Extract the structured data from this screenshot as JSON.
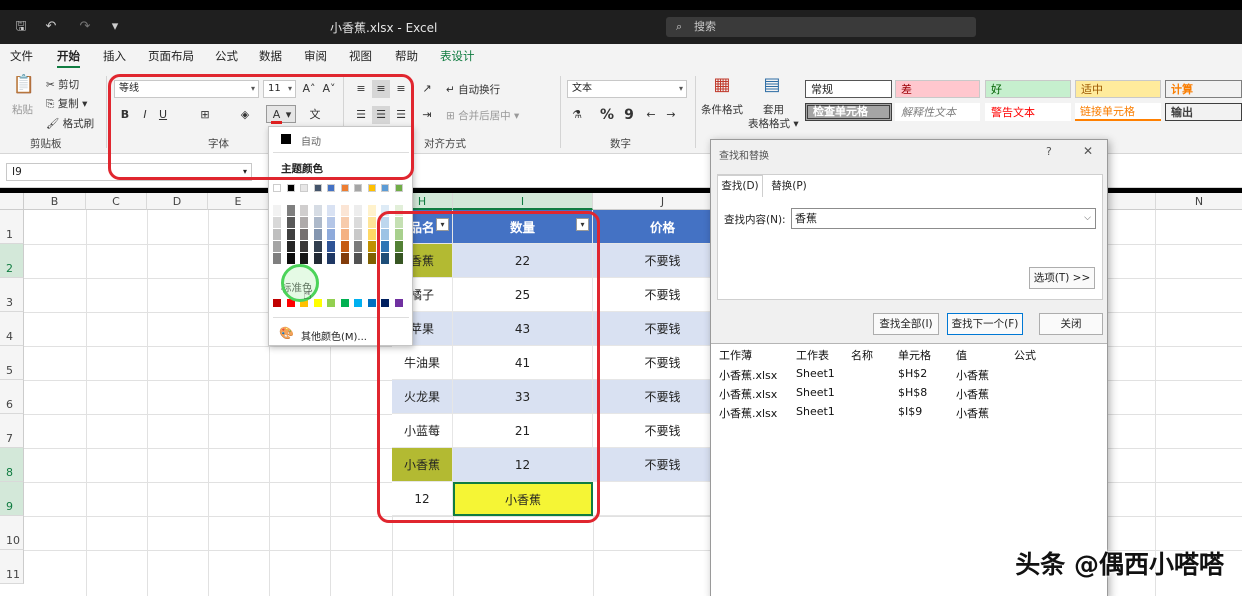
{
  "app": {
    "doc_title": "小香蕉.xlsx - Excel",
    "search_placeholder": "搜索"
  },
  "menu": [
    "文件",
    "开始",
    "插入",
    "页面布局",
    "公式",
    "数据",
    "审阅",
    "视图",
    "帮助",
    "表设计"
  ],
  "ribbon": {
    "paste": "粘贴",
    "cut": "剪切",
    "copy": "复制",
    "format_painter": "格式刷",
    "clipboard": "剪贴板",
    "font_name": "等线",
    "font_size": "11",
    "font_group": "字体",
    "wrap_text": "自动换行",
    "merge_center": "合并后居中",
    "align_group": "对齐方式",
    "number_format": "文本",
    "number_group": "数字",
    "cond_format": "条件格式",
    "table_format_line1": "套用",
    "table_format_line2": "表格格式",
    "styles": [
      "常规",
      "差",
      "好",
      "适中",
      "计算",
      "检查单元格",
      "解释性文本",
      "警告文本",
      "链接单元格",
      "输出"
    ]
  },
  "formula_bar": {
    "name_box": "I9"
  },
  "grid": {
    "columns": [
      "B",
      "C",
      "D",
      "E",
      "H",
      "I",
      "J",
      "N"
    ],
    "rows": [
      "1",
      "2",
      "3",
      "4",
      "5",
      "6",
      "7",
      "8",
      "9",
      "10",
      "11"
    ],
    "header": {
      "h": "品名",
      "i": "数量",
      "j": "价格"
    },
    "data": [
      {
        "h": "香蕉",
        "i": "22",
        "j": "不要钱"
      },
      {
        "h": "橘子",
        "i": "25",
        "j": "不要钱"
      },
      {
        "h": "苹果",
        "i": "43",
        "j": "不要钱"
      },
      {
        "h": "牛油果",
        "i": "41",
        "j": "不要钱"
      },
      {
        "h": "火龙果",
        "i": "33",
        "j": "不要钱"
      },
      {
        "h": "小蓝莓",
        "i": "21",
        "j": "不要钱"
      },
      {
        "h": "小香蕉",
        "i": "12",
        "j": "不要钱"
      },
      {
        "h": "12",
        "i": "小香蕉",
        "j": ""
      }
    ]
  },
  "color_menu": {
    "auto": "自动",
    "theme_colors": "主题颜色",
    "standard_colors": "标准色",
    "more_colors": "其他颜色(M)..."
  },
  "find_dialog": {
    "title": "查找和替换",
    "help": "?",
    "close_x": "✕",
    "tab_find": "查找(D)",
    "tab_replace": "替换(P)",
    "find_label": "查找内容(N):",
    "find_value": "香蕉",
    "options": "选项(T) >>",
    "find_all": "查找全部(I)",
    "find_next": "查找下一个(F)",
    "close": "关闭",
    "result_headers": [
      "工作薄",
      "工作表",
      "名称",
      "单元格",
      "值",
      "公式"
    ],
    "results": [
      {
        "book": "小香蕉.xlsx",
        "sheet": "Sheet1",
        "cell": "$H$2",
        "value": "小香蕉"
      },
      {
        "book": "小香蕉.xlsx",
        "sheet": "Sheet1",
        "cell": "$H$8",
        "value": "小香蕉"
      },
      {
        "book": "小香蕉.xlsx",
        "sheet": "Sheet1",
        "cell": "$I$9",
        "value": "小香蕉"
      }
    ]
  },
  "watermark": "头条 @偶西小嗒嗒",
  "colors": {
    "accent_green": "#107c41",
    "table_header": "#4472c4",
    "band": "#d9e1f2",
    "highlight_olive": "#b3ba32",
    "highlight_yellow": "#f5f535",
    "annotation_red": "#e0262f"
  }
}
